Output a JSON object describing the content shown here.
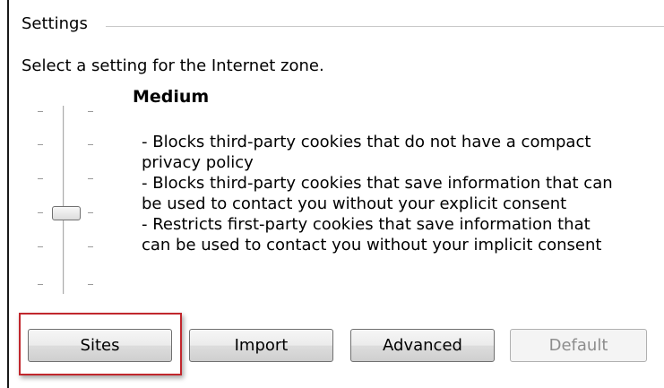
{
  "settings": {
    "group_title": "Settings",
    "zone_prompt": "Select a setting for the Internet zone.",
    "level": {
      "name": "Medium",
      "description": [
        "- Blocks third-party cookies that do not have a compact",
        "privacy policy",
        "- Blocks third-party cookies that save information that can",
        "be used to contact you without your explicit consent",
        "- Restricts first-party cookies that save information that",
        "can be used to contact you without your implicit consent"
      ]
    },
    "slider": {
      "levels": 6,
      "selected_level": "Medium"
    }
  },
  "buttons": {
    "sites": "Sites",
    "import": "Import",
    "advanced": "Advanced",
    "default": "Default"
  },
  "highlight_color": "#c1272d"
}
